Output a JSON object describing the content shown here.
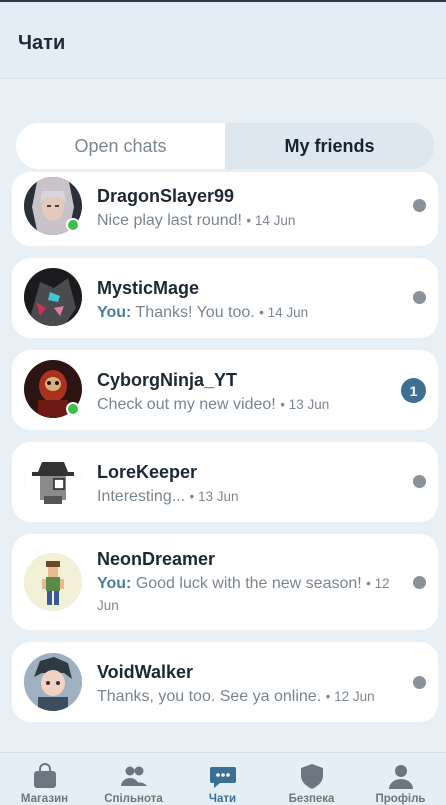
{
  "header": {
    "title": "Чати"
  },
  "tabs": {
    "open": "Open chats",
    "friends": "My friends"
  },
  "chats": [
    {
      "name": "DragonSlayer99",
      "you": "",
      "text": "Nice play last round!",
      "time": "• 14 Jun",
      "online": true,
      "unread": ""
    },
    {
      "name": "MysticMage",
      "you": "You:",
      "text": "Thanks! You too.",
      "time": "• 14 Jun",
      "online": false,
      "unread": ""
    },
    {
      "name": "CyborgNinja_YT",
      "you": "",
      "text": "Check out my new video!",
      "time": "• 13 Jun",
      "online": true,
      "unread": "1"
    },
    {
      "name": "LoreKeeper",
      "you": "",
      "text": "Interesting...",
      "time": "• 13 Jun",
      "online": false,
      "unread": ""
    },
    {
      "name": "NeonDreamer",
      "you": "You:",
      "text": "Good luck with the new season!",
      "time": "• 12 Jun",
      "online": false,
      "unread": ""
    },
    {
      "name": "VoidWalker",
      "you": "",
      "text": "Thanks, you too. See ya online.",
      "time": "• 12 Jun",
      "online": false,
      "unread": ""
    }
  ],
  "nav": [
    {
      "label": "Магазин",
      "icon": "shop-bag-icon"
    },
    {
      "label": "Спільнота",
      "icon": "community-icon"
    },
    {
      "label": "Чати",
      "icon": "chat-icon",
      "active": true
    },
    {
      "label": "Безпека",
      "icon": "shield-icon"
    },
    {
      "label": "Профіль",
      "icon": "profile-icon"
    }
  ]
}
